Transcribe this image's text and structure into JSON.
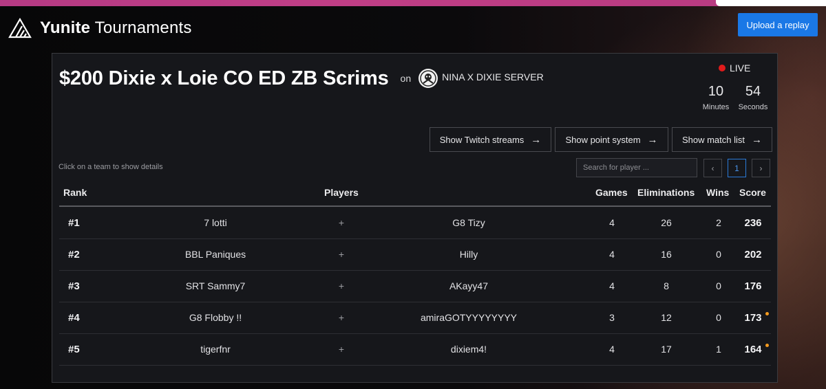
{
  "app": {
    "brand_bold": "Yunite",
    "brand_light": "Tournaments",
    "upload_label": "Upload a replay"
  },
  "tournament": {
    "title": "$200 Dixie x Loie CO ED ZB Scrims",
    "on_label": "on",
    "server_name": "NINA X DIXIE SERVER",
    "live_label": "LIVE",
    "countdown": {
      "minutes": "10",
      "minutes_label": "Minutes",
      "seconds": "54",
      "seconds_label": "Seconds"
    }
  },
  "buttons": {
    "twitch": "Show Twitch streams",
    "points": "Show point system",
    "matches": "Show match list"
  },
  "hint": "Click on a team to show details",
  "search": {
    "placeholder": "Search for player ..."
  },
  "pager": {
    "prev": "‹",
    "current": "1",
    "next": "›"
  },
  "table": {
    "headers": {
      "rank": "Rank",
      "players": "Players",
      "games": "Games",
      "eliminations": "Eliminations",
      "wins": "Wins",
      "score": "Score"
    },
    "plus": "+",
    "rows": [
      {
        "rank": "#1",
        "player1": "7 lotti",
        "player2": "G8 Tizy",
        "games": "4",
        "eliminations": "26",
        "wins": "2",
        "score": "236",
        "badge": false
      },
      {
        "rank": "#2",
        "player1": "BBL Paniques",
        "player2": "Hilly",
        "games": "4",
        "eliminations": "16",
        "wins": "0",
        "score": "202",
        "badge": false
      },
      {
        "rank": "#3",
        "player1": "SRT Sammy7",
        "player2": "AKayy47",
        "games": "4",
        "eliminations": "8",
        "wins": "0",
        "score": "176",
        "badge": false
      },
      {
        "rank": "#4",
        "player1": "G8 Flobby !!",
        "player2": "amiraGOTYYYYYYYY",
        "games": "3",
        "eliminations": "12",
        "wins": "0",
        "score": "173",
        "badge": true
      },
      {
        "rank": "#5",
        "player1": "tigerfnr",
        "player2": "dixiem4!",
        "games": "4",
        "eliminations": "17",
        "wins": "1",
        "score": "164",
        "badge": true
      }
    ]
  },
  "colors": {
    "accent": "#1a78e6",
    "live": "#e01b1b",
    "badge": "#f39a1f",
    "panel": "#16171b"
  }
}
